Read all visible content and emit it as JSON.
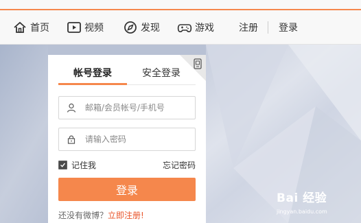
{
  "nav": {
    "home": "首页",
    "video": "视频",
    "discover": "发现",
    "games": "游戏",
    "register": "注册",
    "login": "登录"
  },
  "login_panel": {
    "tab_account": "帐号登录",
    "tab_secure": "安全登录",
    "username_placeholder": "邮箱/会员帐号/手机号",
    "password_placeholder": "请输入密码",
    "remember_me": "记住我",
    "forgot_password": "忘记密码",
    "login_button": "登录",
    "no_account_text": "还没有微博？",
    "register_now": "立即注册!"
  },
  "watermark": {
    "brand": "Bai 经验",
    "url": "jingyan.baidu.com"
  },
  "colors": {
    "accent": "#f5874c",
    "link": "#e9542a"
  }
}
